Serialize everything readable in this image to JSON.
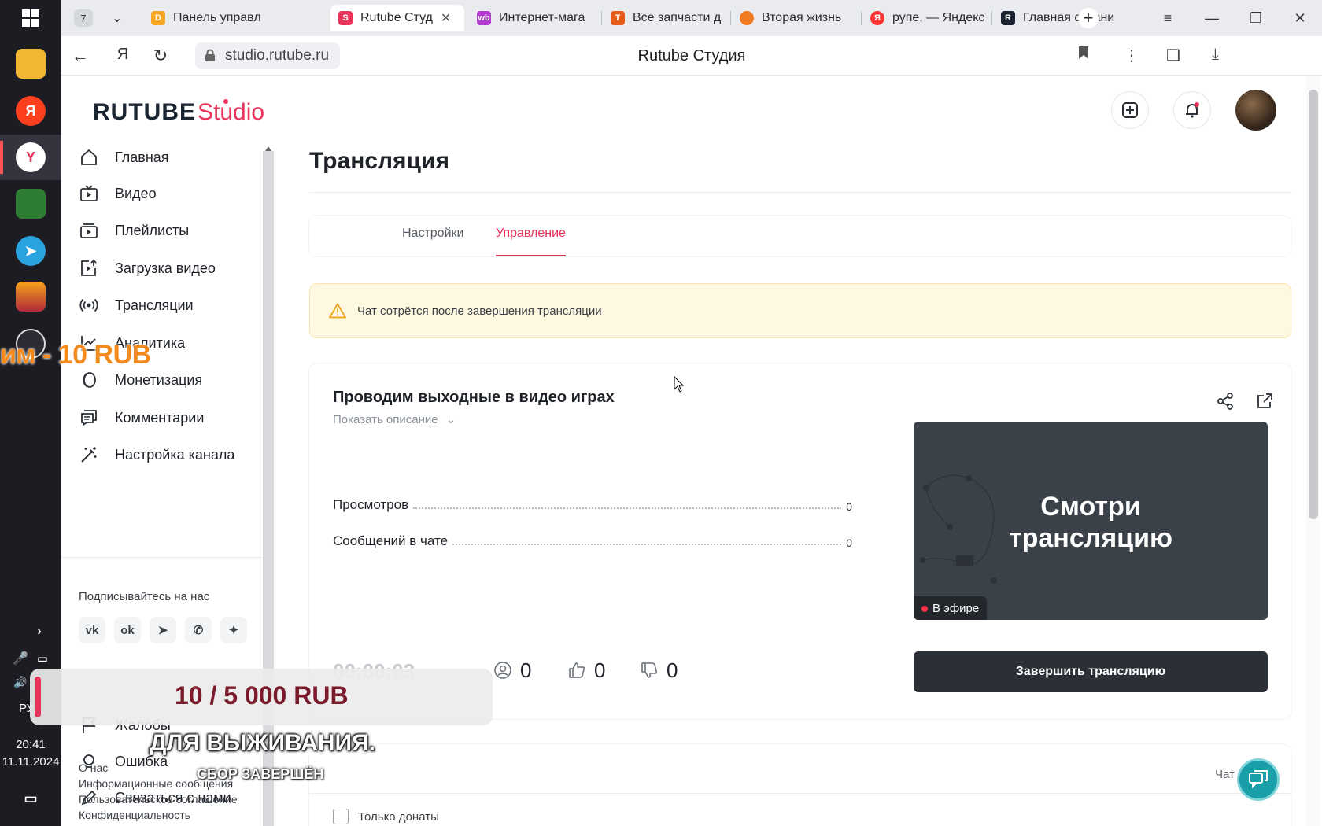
{
  "taskbar": {
    "time": "20:41",
    "date": "11.11.2024",
    "lang": "РУ"
  },
  "browser": {
    "tab_count": "7",
    "tabs": [
      {
        "label": "Панель управл",
        "icon": "d-icon",
        "color": "#f5a623"
      },
      {
        "label": "Rutube Студ",
        "icon": "rutube-studio-icon",
        "color": "#e8335a"
      },
      {
        "label": "Интернет-мага",
        "icon": "wildberries-icon",
        "color": "#b13ccf"
      },
      {
        "label": "Все запчасти д",
        "icon": "t-icon",
        "color": "#e85c1a"
      },
      {
        "label": "Вторая жизнь",
        "icon": "avito-icon",
        "color": "#f07a20"
      },
      {
        "label": "рупе, — Яндекс",
        "icon": "yandex-icon",
        "color": "#f33"
      },
      {
        "label": "Главная страни",
        "icon": "rutube-icon",
        "color": "#1c2330"
      }
    ],
    "url": "studio.rutube.ru",
    "page_title": "Rutube Студия"
  },
  "logo": {
    "brand": "RUTUBE",
    "product": "Studio"
  },
  "sidebar": {
    "items": [
      {
        "label": "Главная",
        "icon": "home-icon"
      },
      {
        "label": "Видео",
        "icon": "video-icon"
      },
      {
        "label": "Плейлисты",
        "icon": "playlist-icon"
      },
      {
        "label": "Загрузка видео",
        "icon": "upload-icon"
      },
      {
        "label": "Трансляции",
        "icon": "broadcast-icon"
      },
      {
        "label": "Аналитика",
        "icon": "analytics-icon"
      },
      {
        "label": "Монетизация",
        "icon": "monetization-icon"
      },
      {
        "label": "Комментарии",
        "icon": "comments-icon"
      },
      {
        "label": "Настройка канала",
        "icon": "magic-wand-icon"
      }
    ],
    "follow_title": "Подписывайтесь на нас",
    "socials": [
      "vk",
      "ok",
      "telegram",
      "viber",
      "dzen"
    ],
    "bottom_items": [
      {
        "label": "Жалобы",
        "icon": "flag-icon"
      },
      {
        "label": "Ошибка",
        "icon": "bulb-icon"
      },
      {
        "label": "Связаться с нами",
        "icon": "edit-icon"
      }
    ],
    "footer_links": [
      "О нас",
      "Информационные сообщения",
      "Пользовательское соглашение",
      "Конфиденциальность"
    ]
  },
  "main": {
    "title": "Трансляция",
    "tabs": [
      {
        "label": "Настройки",
        "active": false
      },
      {
        "label": "Управление",
        "active": true
      }
    ],
    "warning": "Чат сотрётся после завершения трансляции",
    "stream": {
      "title": "Проводим выходные в видео играх",
      "show_description": "Показать описание",
      "stats": [
        {
          "label": "Просмотров",
          "value": "0"
        },
        {
          "label": "Сообщений в чате",
          "value": "0"
        }
      ],
      "preview_text_line1": "Смотри",
      "preview_text_line2": "трансляцию",
      "live_badge": "В эфире",
      "end_button": "Завершить трансляцию",
      "timer": "00:00:03",
      "viewers": "0",
      "likes": "0",
      "dislikes": "0"
    },
    "chat": {
      "label": "Чат",
      "only_donations": "Только донаты"
    }
  },
  "overlay": {
    "left_text": "им - 10 RUB",
    "goal": "10 / 5 000 RUB",
    "caption": "ДЛЯ ВЫЖИВАНИЯ.",
    "sub": "СБОР ЗАВЕРШЁН"
  },
  "colors": {
    "accent": "#e8335a",
    "dark_button": "#2a3036",
    "warning_bg": "#fff8e1"
  }
}
